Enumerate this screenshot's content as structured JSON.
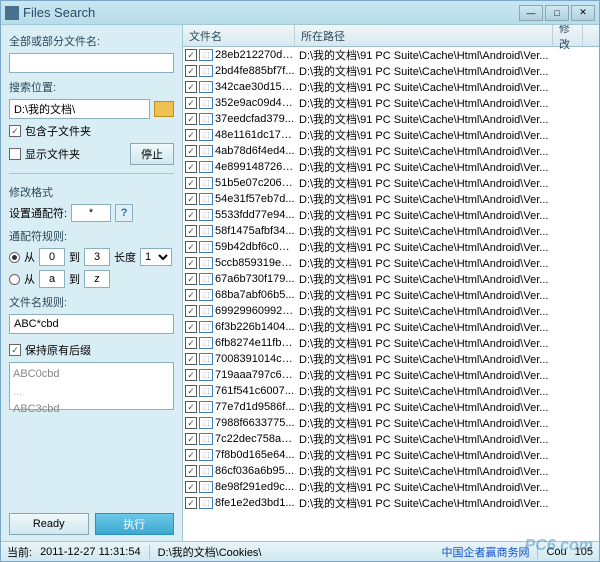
{
  "title": "Files Search",
  "sidebar": {
    "filename_label": "全部或部分文件名:",
    "filename_value": "",
    "location_label": "搜索位置:",
    "location_value": "D:\\我的文档\\",
    "include_sub": "包含子文件夹",
    "show_folders": "显示文件夹",
    "stop": "停止",
    "modify_format": "修改格式",
    "set_wildcard": "设置通配符:",
    "wildcard_value": "*",
    "wildcard_rules": "通配符规则:",
    "from": "从",
    "to": "到",
    "range_from_num": "0",
    "range_to_num": "3",
    "length_label": "长度",
    "length_value": "1",
    "range_from_char": "a",
    "range_to_char": "z",
    "filename_rule_label": "文件名规则:",
    "filename_rule_value": "ABC*cbd",
    "keep_suffix": "保持原有后缀",
    "preview1": "ABC0cbd",
    "preview2": "ABC3cbd",
    "ready": "Ready",
    "execute": "执行"
  },
  "headers": {
    "c1": "文件名",
    "c2": "所在路径",
    "c3": "修改"
  },
  "files": [
    {
      "name": "28eb212270dc...",
      "path": "D:\\我的文档\\91 PC Suite\\Cache\\Html\\Android\\Ver..."
    },
    {
      "name": "2bd4fe885bf7f...",
      "path": "D:\\我的文档\\91 PC Suite\\Cache\\Html\\Android\\Ver..."
    },
    {
      "name": "342cae30d15c...",
      "path": "D:\\我的文档\\91 PC Suite\\Cache\\Html\\Android\\Ver..."
    },
    {
      "name": "352e9ac09d44...",
      "path": "D:\\我的文档\\91 PC Suite\\Cache\\Html\\Android\\Ver..."
    },
    {
      "name": "37eedcfad379...",
      "path": "D:\\我的文档\\91 PC Suite\\Cache\\Html\\Android\\Ver..."
    },
    {
      "name": "48e1161dc174...",
      "path": "D:\\我的文档\\91 PC Suite\\Cache\\Html\\Android\\Ver..."
    },
    {
      "name": "4ab78d6f4ed4...",
      "path": "D:\\我的文档\\91 PC Suite\\Cache\\Html\\Android\\Ver..."
    },
    {
      "name": "4e8991487266...",
      "path": "D:\\我的文档\\91 PC Suite\\Cache\\Html\\Android\\Ver..."
    },
    {
      "name": "51b5e07c206a...",
      "path": "D:\\我的文档\\91 PC Suite\\Cache\\Html\\Android\\Ver..."
    },
    {
      "name": "54e31f57eb7d...",
      "path": "D:\\我的文档\\91 PC Suite\\Cache\\Html\\Android\\Ver..."
    },
    {
      "name": "5533fdd77e94...",
      "path": "D:\\我的文档\\91 PC Suite\\Cache\\Html\\Android\\Ver..."
    },
    {
      "name": "58f1475afbf34...",
      "path": "D:\\我的文档\\91 PC Suite\\Cache\\Html\\Android\\Ver..."
    },
    {
      "name": "59b42dbf6c065...",
      "path": "D:\\我的文档\\91 PC Suite\\Cache\\Html\\Android\\Ver..."
    },
    {
      "name": "5ccb859319ea...",
      "path": "D:\\我的文档\\91 PC Suite\\Cache\\Html\\Android\\Ver..."
    },
    {
      "name": "67a6b730f179...",
      "path": "D:\\我的文档\\91 PC Suite\\Cache\\Html\\Android\\Ver..."
    },
    {
      "name": "68ba7abf06b5...",
      "path": "D:\\我的文档\\91 PC Suite\\Cache\\Html\\Android\\Ver..."
    },
    {
      "name": "699299609927...",
      "path": "D:\\我的文档\\91 PC Suite\\Cache\\Html\\Android\\Ver..."
    },
    {
      "name": "6f3b226b1404...",
      "path": "D:\\我的文档\\91 PC Suite\\Cache\\Html\\Android\\Ver..."
    },
    {
      "name": "6fb8274e11fb4...",
      "path": "D:\\我的文档\\91 PC Suite\\Cache\\Html\\Android\\Ver..."
    },
    {
      "name": "7008391014ca...",
      "path": "D:\\我的文档\\91 PC Suite\\Cache\\Html\\Android\\Ver..."
    },
    {
      "name": "719aaa797c65...",
      "path": "D:\\我的文档\\91 PC Suite\\Cache\\Html\\Android\\Ver..."
    },
    {
      "name": "761f541c6007...",
      "path": "D:\\我的文档\\91 PC Suite\\Cache\\Html\\Android\\Ver..."
    },
    {
      "name": "77e7d1d9586f...",
      "path": "D:\\我的文档\\91 PC Suite\\Cache\\Html\\Android\\Ver..."
    },
    {
      "name": "7988f6633775...",
      "path": "D:\\我的文档\\91 PC Suite\\Cache\\Html\\Android\\Ver..."
    },
    {
      "name": "7c22dec758a5...",
      "path": "D:\\我的文档\\91 PC Suite\\Cache\\Html\\Android\\Ver..."
    },
    {
      "name": "7f8b0d165e64...",
      "path": "D:\\我的文档\\91 PC Suite\\Cache\\Html\\Android\\Ver..."
    },
    {
      "name": "86cf036a6b95...",
      "path": "D:\\我的文档\\91 PC Suite\\Cache\\Html\\Android\\Ver..."
    },
    {
      "name": "8e98f291ed9c...",
      "path": "D:\\我的文档\\91 PC Suite\\Cache\\Html\\Android\\Ver..."
    },
    {
      "name": "8fe1e2ed3bd1...",
      "path": "D:\\我的文档\\91 PC Suite\\Cache\\Html\\Android\\Ver..."
    }
  ],
  "status": {
    "time_label": "当前:",
    "time": "2011-12-27 11:31:54",
    "path": "D:\\我的文档\\Cookies\\",
    "link": "中国企者赢商务网",
    "count_label": "Cou",
    "count": "105"
  },
  "watermark": "PC6.com"
}
